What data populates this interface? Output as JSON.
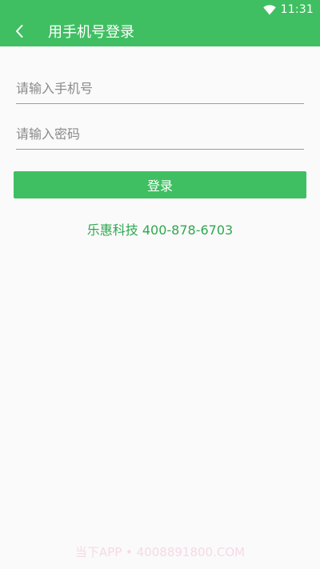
{
  "status_bar": {
    "time": "11:31",
    "wifi_icon": "wifi-icon"
  },
  "app_bar": {
    "back_icon": "chevron-left-icon",
    "title": "用手机号登录"
  },
  "form": {
    "phone_placeholder": "请输入手机号",
    "phone_value": "",
    "password_placeholder": "请输入密码",
    "password_value": "",
    "login_label": "登录"
  },
  "footer": {
    "company_info": "乐惠科技 400-878-6703"
  },
  "watermark": {
    "text": "当下APP • 4008891800.COM"
  },
  "colors": {
    "primary": "#3fbf62",
    "company_text": "#2ea84f",
    "background": "#fafafa"
  }
}
